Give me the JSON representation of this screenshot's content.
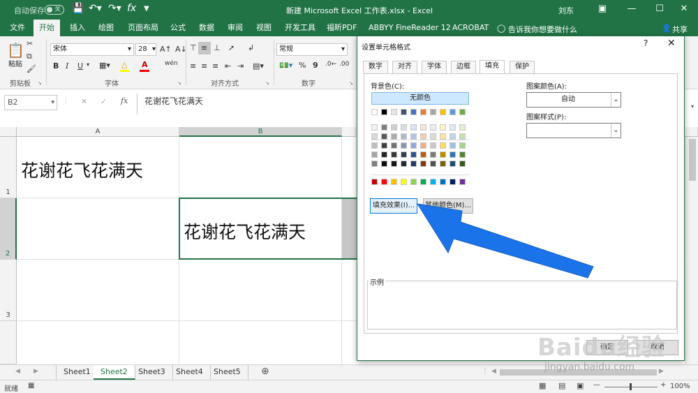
{
  "titlebar": {
    "autosave": "自动保存",
    "toggle": "关",
    "doc_title": "新建 Microsoft Excel 工作表.xlsx  -  Excel",
    "user": "刘东",
    "undo_icon": "undo-icon",
    "redo_icon": "redo-icon"
  },
  "tabs": [
    "文件",
    "开始",
    "插入",
    "绘图",
    "页面布局",
    "公式",
    "数据",
    "审阅",
    "视图",
    "开发工具",
    "福昕PDF",
    "ABBYY FineReader 12",
    "ACROBAT"
  ],
  "tell_me": "告诉我你想要做什么",
  "share": "共享",
  "ribbon": {
    "paste": "粘贴",
    "clipboard": "剪贴板",
    "font_name": "宋体",
    "font_size": "28",
    "font_group": "字体",
    "bold": "B",
    "italic": "I",
    "underline": "U",
    "align_group": "对齐方式",
    "number_format": "常规",
    "number_group": "数字",
    "percent": "%",
    "comma": "9"
  },
  "formula_bar": {
    "name_box": "B2",
    "fx": "fx",
    "content": "花谢花飞花满天"
  },
  "grid": {
    "columns": [
      "A",
      "B"
    ],
    "rows": [
      "1",
      "2",
      "3"
    ],
    "a1": "花谢花飞花满天",
    "b2": "花谢花飞花满天"
  },
  "sheets": [
    "Sheet1",
    "Sheet2",
    "Sheet3",
    "Sheet4",
    "Sheet5"
  ],
  "active_sheet": "Sheet2",
  "status": {
    "ready": "就绪",
    "zoom": "100%"
  },
  "dialog": {
    "title": "设置单元格格式",
    "help": "?",
    "tabs": [
      "数字",
      "对齐",
      "字体",
      "边框",
      "填充",
      "保护"
    ],
    "active_tab": "填充",
    "bg_color_label": "背景色(C):",
    "no_color": "无颜色",
    "fill_effects": "填充效果(I)...",
    "more_colors": "其他颜色(M)...",
    "pattern_color_label": "图案颜色(A):",
    "pattern_color_value": "自动",
    "pattern_style_label": "图案样式(P):",
    "sample_label": "示例",
    "ok": "确定",
    "cancel": "取消"
  },
  "palette": {
    "theme_top": [
      "#ffffff",
      "#000000",
      "#e7e6e6",
      "#44546a",
      "#4472c4",
      "#ed7d31",
      "#a5a5a5",
      "#ffc000",
      "#5b9bd5",
      "#70ad47"
    ],
    "theme_rows": [
      [
        "#f2f2f2",
        "#808080",
        "#d0cece",
        "#d6dce4",
        "#d9e2f3",
        "#fbe5d5",
        "#ededed",
        "#fff2cc",
        "#deeaf6",
        "#e2efd9"
      ],
      [
        "#d9d9d9",
        "#595959",
        "#aeaaaa",
        "#adb9ca",
        "#b4c6e7",
        "#f7cbac",
        "#dbdbdb",
        "#fee599",
        "#bdd7ee",
        "#c5e0b3"
      ],
      [
        "#bfbfbf",
        "#404040",
        "#757171",
        "#8496b0",
        "#8eaadb",
        "#f4b083",
        "#c9c9c9",
        "#ffd965",
        "#9cc2e5",
        "#a8d08d"
      ],
      [
        "#a6a6a6",
        "#262626",
        "#3a3838",
        "#323f4f",
        "#2f5496",
        "#c55a11",
        "#7b7b7b",
        "#bf8f00",
        "#2e75b5",
        "#538135"
      ],
      [
        "#808080",
        "#0d0d0d",
        "#171616",
        "#222a35",
        "#1f3864",
        "#833c0b",
        "#525252",
        "#7f6000",
        "#1f4e79",
        "#375623"
      ]
    ],
    "standard": [
      "#c00000",
      "#ff0000",
      "#ffc000",
      "#ffff00",
      "#92d050",
      "#00b050",
      "#00b0f0",
      "#0070c0",
      "#002060",
      "#7030a0"
    ]
  },
  "watermark": {
    "brand": "Baidu经验",
    "url": "jingyan.baidu.com"
  },
  "colors": {
    "excel_green": "#217346",
    "arrow_blue": "#1a73e8"
  }
}
